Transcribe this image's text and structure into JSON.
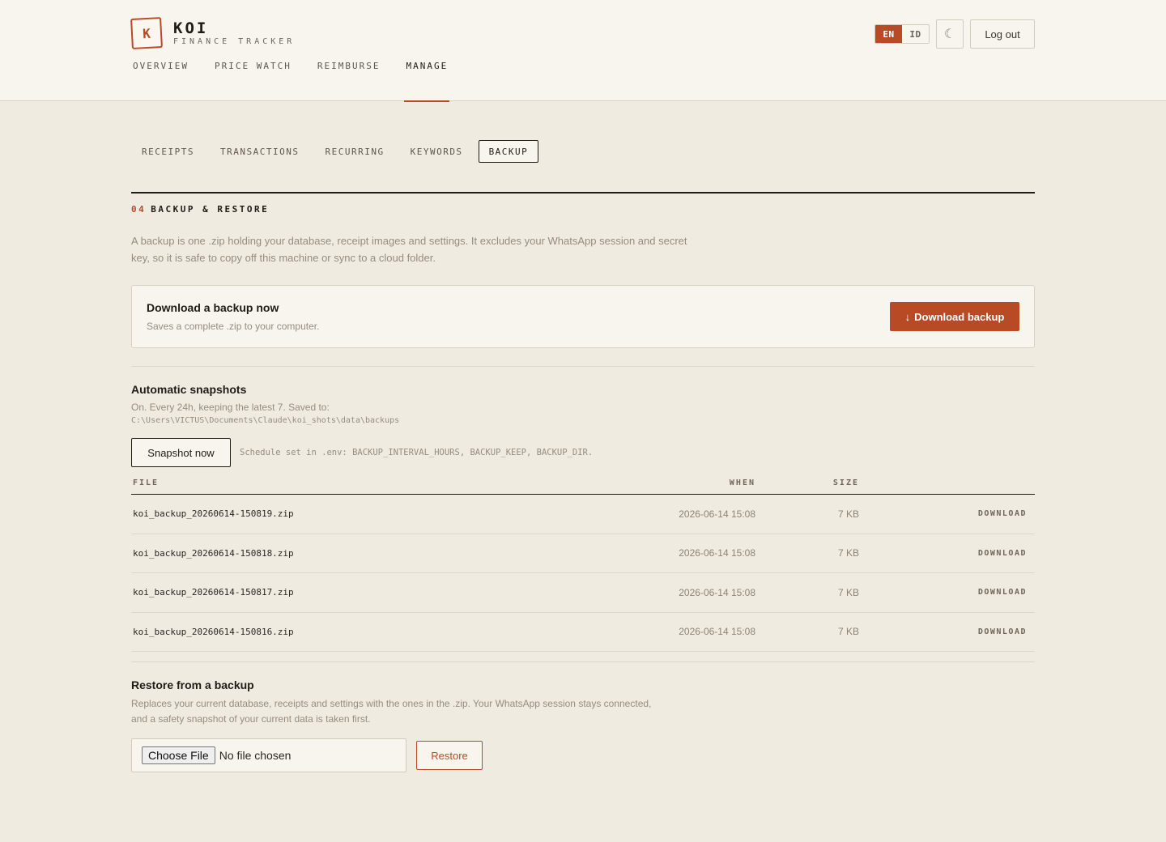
{
  "brand": {
    "logo_letter": "K",
    "title": "KOI",
    "subtitle": "FINANCE TRACKER"
  },
  "top_actions": {
    "languages": [
      {
        "label": "EN",
        "active": true
      },
      {
        "label": "ID",
        "active": false
      }
    ],
    "theme_icon": "moon-icon",
    "logout_label": "Log out"
  },
  "main_nav": [
    {
      "label": "OVERVIEW",
      "active": false
    },
    {
      "label": "PRICE WATCH",
      "active": false
    },
    {
      "label": "REIMBURSE",
      "active": false
    },
    {
      "label": "MANAGE",
      "active": true
    }
  ],
  "sub_tabs": [
    {
      "label": "RECEIPTS",
      "active": false
    },
    {
      "label": "TRANSACTIONS",
      "active": false
    },
    {
      "label": "RECURRING",
      "active": false
    },
    {
      "label": "KEYWORDS",
      "active": false
    },
    {
      "label": "BACKUP",
      "active": true
    }
  ],
  "section": {
    "number": "04",
    "title": "BACKUP & RESTORE",
    "intro": "A backup is one .zip holding your database, receipt images and settings. It excludes your WhatsApp session and secret key, so it is safe to copy off this machine or sync to a cloud folder."
  },
  "download_card": {
    "title": "Download a backup now",
    "subtitle": "Saves a complete .zip to your computer.",
    "button_icon": "↓",
    "button_label": "Download backup"
  },
  "snapshots": {
    "title": "Automatic snapshots",
    "description": "On. Every 24h, keeping the latest 7. Saved to:",
    "path": "C:\\Users\\VICTUS\\Documents\\Claude\\koi_shots\\data\\backups",
    "button_label": "Snapshot now",
    "note": "Schedule set in .env: BACKUP_INTERVAL_HOURS, BACKUP_KEEP, BACKUP_DIR.",
    "columns": {
      "file": "FILE",
      "when": "WHEN",
      "size": "SIZE"
    },
    "rows": [
      {
        "file": "koi_backup_20260614-150819.zip",
        "when": "2026-06-14 15:08",
        "size": "7 KB",
        "action": "DOWNLOAD"
      },
      {
        "file": "koi_backup_20260614-150818.zip",
        "when": "2026-06-14 15:08",
        "size": "7 KB",
        "action": "DOWNLOAD"
      },
      {
        "file": "koi_backup_20260614-150817.zip",
        "when": "2026-06-14 15:08",
        "size": "7 KB",
        "action": "DOWNLOAD"
      },
      {
        "file": "koi_backup_20260614-150816.zip",
        "when": "2026-06-14 15:08",
        "size": "7 KB",
        "action": "DOWNLOAD"
      }
    ]
  },
  "restore": {
    "title": "Restore from a backup",
    "description": "Replaces your current database, receipts and settings with the ones in the .zip. Your WhatsApp session stays connected, and a safety snapshot of your current data is taken first.",
    "choose_label": "Choose File",
    "file_status": "No file chosen",
    "button_label": "Restore"
  },
  "colors": {
    "accent": "#b84a26",
    "background": "#f0ebe1",
    "surface": "#f8f5ee",
    "ink": "#1f1b16",
    "muted": "#958c7e"
  }
}
